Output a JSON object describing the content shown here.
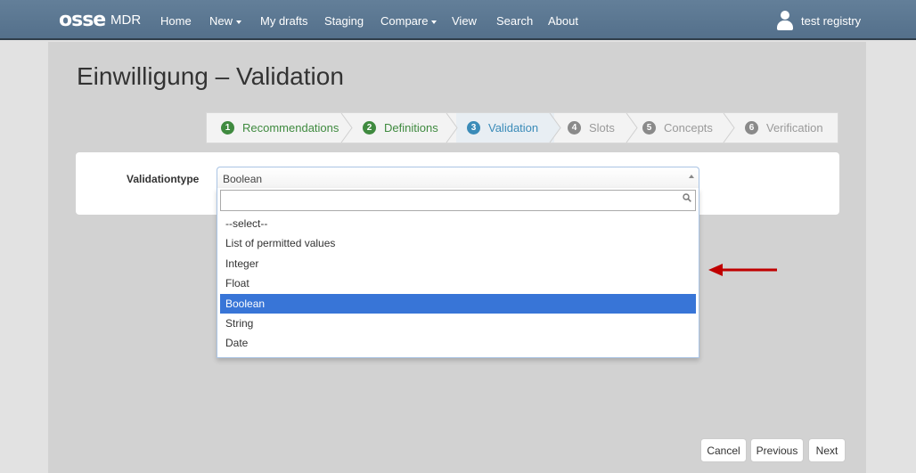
{
  "navbar": {
    "logo_text": "osse",
    "brand": "MDR",
    "items": [
      {
        "label": "Home",
        "dropdown": false
      },
      {
        "label": "New",
        "dropdown": true
      },
      {
        "label": "My drafts",
        "dropdown": false
      },
      {
        "label": "Staging",
        "dropdown": false
      },
      {
        "label": "Compare",
        "dropdown": true
      },
      {
        "label": "View",
        "dropdown": false
      },
      {
        "label": "Search",
        "dropdown": false
      },
      {
        "label": "About",
        "dropdown": false
      }
    ],
    "user": {
      "name": "test registry",
      "icon": "user-icon"
    }
  },
  "page": {
    "title": "Einwilligung – Validation"
  },
  "wizard": {
    "steps": [
      {
        "number": "1",
        "label": "Recommendations",
        "state": "done"
      },
      {
        "number": "2",
        "label": "Definitions",
        "state": "done"
      },
      {
        "number": "3",
        "label": "Validation",
        "state": "active"
      },
      {
        "number": "4",
        "label": "Slots",
        "state": "todo"
      },
      {
        "number": "5",
        "label": "Concepts",
        "state": "todo"
      },
      {
        "number": "6",
        "label": "Verification",
        "state": "todo"
      }
    ]
  },
  "form": {
    "validationtype_label": "Validationtype",
    "select": {
      "value": "Boolean",
      "search_value": "",
      "options": [
        "--select--",
        "List of permitted values",
        "Integer",
        "Float",
        "Boolean",
        "String",
        "Date"
      ],
      "selected_option": "Boolean"
    }
  },
  "annotation": {
    "icon": "arrow-left-icon",
    "color": "#c00000"
  },
  "buttons": {
    "cancel": "Cancel",
    "previous": "Previous",
    "next": "Next"
  },
  "colors": {
    "navbar": "#5b7791",
    "step_done": "#3f8a3f",
    "step_active": "#3a8bb8",
    "step_todo": "#8a8a8a",
    "option_highlight": "#3875d7"
  }
}
